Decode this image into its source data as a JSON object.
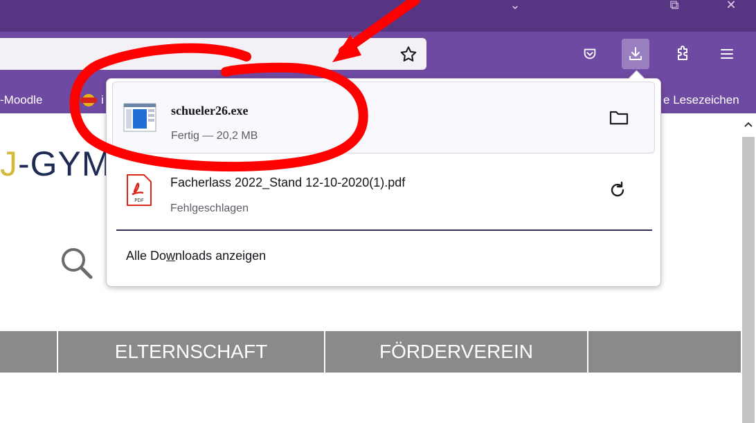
{
  "window": {
    "minimize_glyph": "⌄",
    "restore_glyph": "⧉",
    "close_glyph": "✕"
  },
  "toolbar": {
    "icons": [
      "star-icon",
      "pocket-icon",
      "download-icon",
      "extensions-icon",
      "menu-icon"
    ]
  },
  "bookmarks": {
    "left_label": "-Moodle",
    "partial_after_favicon": "i",
    "right_label": "Lesezeichen",
    "right_prefix": "e"
  },
  "page": {
    "logo_text_yellow": "J",
    "logo_text": "-GYM",
    "menu": [
      "",
      "ELTERNSCHAFT",
      "FÖRDERVEREIN",
      ""
    ]
  },
  "downloads": {
    "items": [
      {
        "name": "schueler26.exe",
        "status": "Fertig — 20,2 MB",
        "icon": "exe-file-icon",
        "action": "folder-icon"
      },
      {
        "name": "Facherlass 2022_Stand 12-10-2020(1).pdf",
        "status": "Fehlgeschlagen",
        "icon": "pdf-file-icon",
        "action": "retry-icon"
      }
    ],
    "show_all_pre": "Alle Do",
    "show_all_accel": "w",
    "show_all_post": "nloads anzeigen"
  },
  "colors": {
    "titlebar": "#583583",
    "toolbar": "#6f4aa2",
    "annotation": "#ff0000",
    "menu_strip": "#8a8a8a"
  }
}
